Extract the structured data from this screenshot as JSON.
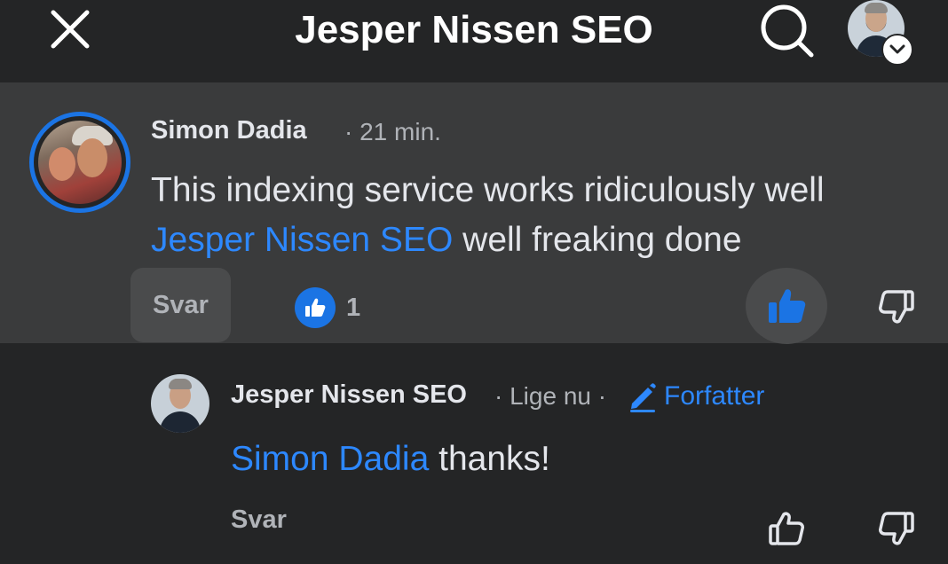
{
  "header": {
    "title": "Jesper Nissen SEO",
    "icons": {
      "close": "close-icon",
      "search": "search-icon",
      "profile_menu": "chevron-down-icon"
    }
  },
  "comments": [
    {
      "author": "Simon Dadia",
      "separator": "·",
      "time": "21 min.",
      "text_before": "This indexing service works ridiculously well ",
      "mention": "Jesper Nissen SEO",
      "text_after": " well freaking done",
      "reply_label": "Svar",
      "like_count": "1",
      "liked": true
    },
    {
      "author": "Jesper Nissen SEO",
      "separator": "·",
      "time": "Lige nu",
      "badge": "Forfatter",
      "mention": "Simon Dadia",
      "text_after": " thanks!",
      "reply_label": "Svar",
      "liked": false
    }
  ],
  "colors": {
    "background": "#242526",
    "highlight": "#3a3b3c",
    "accent": "#1b74e4",
    "mention": "#2d88ff",
    "text": "#e4e6eb",
    "muted": "#b0b3b8"
  }
}
